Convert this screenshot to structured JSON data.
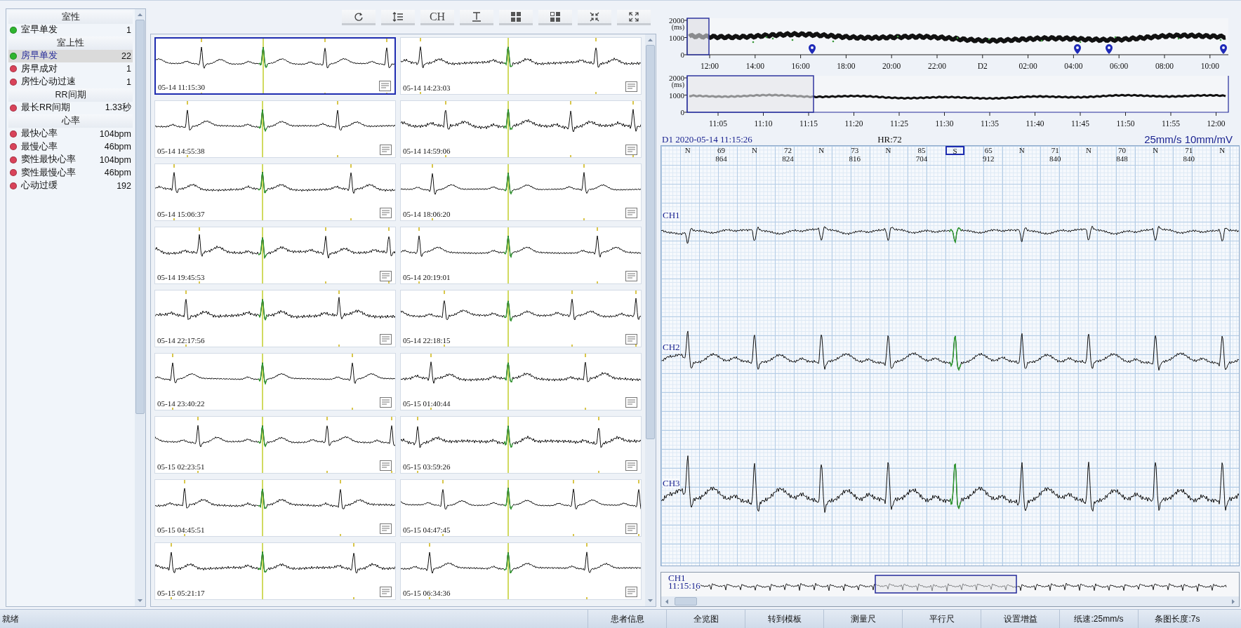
{
  "sidebar": {
    "sections": [
      {
        "title": "室性",
        "items": [
          {
            "label": "室早单发",
            "value": "1",
            "color": "#2fb52f",
            "selected": false
          }
        ]
      },
      {
        "title": "室上性",
        "items": [
          {
            "label": "房早单发",
            "value": "22",
            "color": "#2fb52f",
            "selected": true
          },
          {
            "label": "房早成对",
            "value": "1",
            "color": "#d9435a",
            "selected": false
          },
          {
            "label": "房性心动过速",
            "value": "1",
            "color": "#d9435a",
            "selected": false
          }
        ]
      },
      {
        "title": "RR间期",
        "items": [
          {
            "label": "最长RR间期",
            "value": "1.33秒",
            "color": "#d9435a",
            "selected": false
          }
        ]
      },
      {
        "title": "心率",
        "items": [
          {
            "label": "最快心率",
            "value": "104bpm",
            "color": "#d9435a",
            "selected": false
          },
          {
            "label": "最慢心率",
            "value": "46bpm",
            "color": "#d9435a",
            "selected": false
          },
          {
            "label": "窦性最快心率",
            "value": "104bpm",
            "color": "#d9435a",
            "selected": false
          },
          {
            "label": "窦性最慢心率",
            "value": "46bpm",
            "color": "#d9435a",
            "selected": false
          },
          {
            "label": "心动过缓",
            "value": "192",
            "color": "#d9435a",
            "selected": false
          }
        ]
      }
    ]
  },
  "toolbar": [
    {
      "kind": "refresh"
    },
    {
      "kind": "spacing"
    },
    {
      "kind": "label",
      "label": "CH"
    },
    {
      "kind": "text-height"
    },
    {
      "kind": "grid"
    },
    {
      "kind": "grid-partial"
    },
    {
      "kind": "shrink"
    },
    {
      "kind": "expand"
    }
  ],
  "strips": [
    {
      "time": "05-14 11:15:30",
      "selected": true
    },
    {
      "time": "05-14 14:23:03",
      "selected": false
    },
    {
      "time": "05-14 14:55:38",
      "selected": false
    },
    {
      "time": "05-14 14:59:06",
      "selected": false
    },
    {
      "time": "05-14 15:06:37",
      "selected": false
    },
    {
      "time": "05-14 18:06:20",
      "selected": false
    },
    {
      "time": "05-14 19:45:53",
      "selected": false
    },
    {
      "time": "05-14 20:19:01",
      "selected": false
    },
    {
      "time": "05-14 22:17:56",
      "selected": false
    },
    {
      "time": "05-14 22:18:15",
      "selected": false
    },
    {
      "time": "05-14 23:40:22",
      "selected": false
    },
    {
      "time": "05-15 01:40:44",
      "selected": false
    },
    {
      "time": "05-15 02:23:51",
      "selected": false
    },
    {
      "time": "05-15 03:59:26",
      "selected": false
    },
    {
      "time": "05-15 04:45:51",
      "selected": false
    },
    {
      "time": "05-15 04:47:45",
      "selected": false
    },
    {
      "time": "05-15 05:21:17",
      "selected": false
    },
    {
      "time": "05-15 06:34:36",
      "selected": false
    }
  ],
  "trend": {
    "y_labels": [
      "2000",
      "(ms)",
      "1000",
      "0"
    ],
    "x_labels": [
      "12:00",
      "14:00",
      "16:00",
      "18:00",
      "20:00",
      "22:00",
      "D2",
      "02:00",
      "04:00",
      "06:00",
      "08:00",
      "10:00"
    ]
  },
  "zoom_trend": {
    "y_labels": [
      "2000",
      "(ms)",
      "1000",
      "0"
    ],
    "x_labels": [
      "11:05",
      "11:10",
      "11:15",
      "11:20",
      "11:25",
      "11:30",
      "11:35",
      "11:40",
      "11:45",
      "11:50",
      "11:55",
      "12:00"
    ]
  },
  "ecg": {
    "title": "D1 2020-05-14 11:15:26",
    "hr": "HR:72",
    "scale": "25mm/s 10mm/mV",
    "annotations": [
      {
        "kind": "beat",
        "label": "N",
        "selected": false
      },
      {
        "kind": "interval",
        "hr": "69",
        "rr": "864"
      },
      {
        "kind": "beat",
        "label": "N",
        "selected": false
      },
      {
        "kind": "interval",
        "hr": "72",
        "rr": "824"
      },
      {
        "kind": "beat",
        "label": "N",
        "selected": false
      },
      {
        "kind": "interval",
        "hr": "73",
        "rr": "816"
      },
      {
        "kind": "beat",
        "label": "N",
        "selected": false
      },
      {
        "kind": "interval",
        "hr": "85",
        "rr": "704"
      },
      {
        "kind": "beat",
        "label": "S",
        "selected": true
      },
      {
        "kind": "interval",
        "hr": "65",
        "rr": "912"
      },
      {
        "kind": "beat",
        "label": "N",
        "selected": false
      },
      {
        "kind": "interval",
        "hr": "71",
        "rr": "840"
      },
      {
        "kind": "beat",
        "label": "N",
        "selected": false
      },
      {
        "kind": "interval",
        "hr": "70",
        "rr": "848"
      },
      {
        "kind": "beat",
        "label": "N",
        "selected": false
      },
      {
        "kind": "interval",
        "hr": "71",
        "rr": "840"
      },
      {
        "kind": "beat",
        "label": "N",
        "selected": false
      }
    ],
    "channels": [
      "CH1",
      "CH2",
      "CH3"
    ]
  },
  "overview": {
    "channel": "CH1",
    "time": "11:15:16"
  },
  "status_bar": {
    "status": "就绪",
    "buttons": [
      "患者信息",
      "全览图",
      "转到模板",
      "测量尺",
      "平行尺",
      "设置增益"
    ],
    "fields": [
      "纸速:25mm/s",
      "条图长度:7s"
    ]
  }
}
